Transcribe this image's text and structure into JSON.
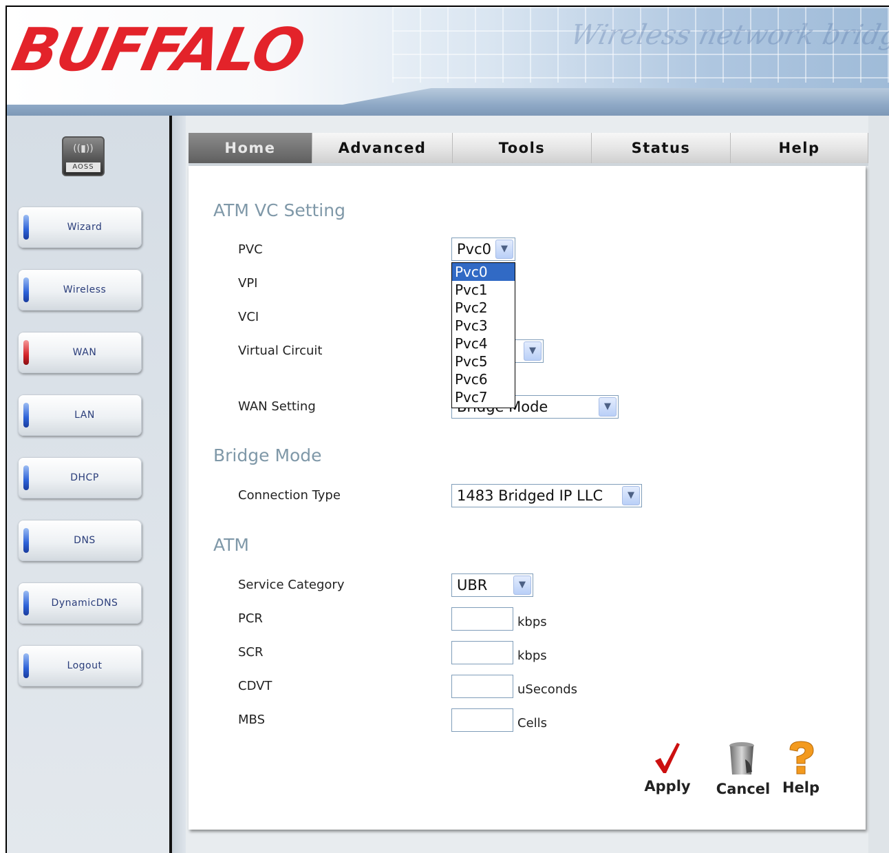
{
  "brand": {
    "logo_text": "BUFFALO",
    "header_script": "Wireless network bridge"
  },
  "sidebar": {
    "aoss_label": "AOSS",
    "items": [
      {
        "label": "Wizard",
        "active": false
      },
      {
        "label": "Wireless",
        "active": false
      },
      {
        "label": "WAN",
        "active": true
      },
      {
        "label": "LAN",
        "active": false
      },
      {
        "label": "DHCP",
        "active": false
      },
      {
        "label": "DNS",
        "active": false
      },
      {
        "label": "DynamicDNS",
        "active": false
      },
      {
        "label": "Logout",
        "active": false
      }
    ]
  },
  "tabs": [
    {
      "label": "Home",
      "active": true
    },
    {
      "label": "Advanced",
      "active": false
    },
    {
      "label": "Tools",
      "active": false
    },
    {
      "label": "Status",
      "active": false
    },
    {
      "label": "Help",
      "active": false
    }
  ],
  "atm_vc": {
    "title": "ATM VC Setting",
    "pvc_label": "PVC",
    "pvc_value": "Pvc0",
    "pvc_options": [
      "Pvc0",
      "Pvc1",
      "Pvc2",
      "Pvc3",
      "Pvc4",
      "Pvc5",
      "Pvc6",
      "Pvc7"
    ],
    "vpi_label": "VPI",
    "vci_label": "VCI",
    "virtual_circuit_label": "Virtual Circuit",
    "wan_setting_label": "WAN Setting",
    "wan_setting_value": "Bridge Mode"
  },
  "bridge": {
    "title": "Bridge Mode",
    "connection_type_label": "Connection Type",
    "connection_type_value": "1483 Bridged IP LLC"
  },
  "atm": {
    "title": "ATM",
    "service_category_label": "Service Category",
    "service_category_value": "UBR",
    "pcr_label": "PCR",
    "pcr_unit": "kbps",
    "scr_label": "SCR",
    "scr_unit": "kbps",
    "cdvt_label": "CDVT",
    "cdvt_unit": "uSeconds",
    "mbs_label": "MBS",
    "mbs_unit": "Cells"
  },
  "actions": {
    "apply": "Apply",
    "cancel": "Cancel",
    "help": "Help"
  },
  "colors": {
    "logo_red": "#e3232a",
    "section_title": "#7f98a8",
    "selection_blue": "#316ac5",
    "help_orange": "#f39a1e",
    "apply_red": "#cc1010"
  }
}
